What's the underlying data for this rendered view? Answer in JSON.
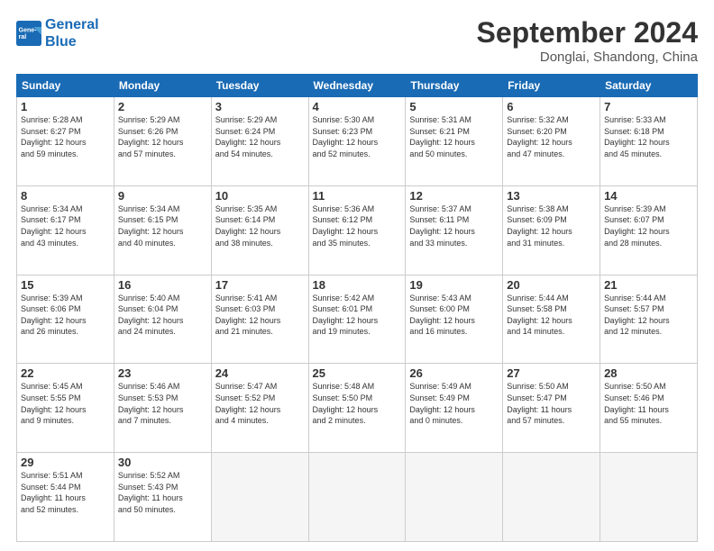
{
  "header": {
    "logo": {
      "line1": "General",
      "line2": "Blue"
    },
    "month": "September 2024",
    "location": "Donglai, Shandong, China"
  },
  "weekdays": [
    "Sunday",
    "Monday",
    "Tuesday",
    "Wednesday",
    "Thursday",
    "Friday",
    "Saturday"
  ],
  "weeks": [
    [
      {
        "day": 1,
        "info": "Sunrise: 5:28 AM\nSunset: 6:27 PM\nDaylight: 12 hours\nand 59 minutes."
      },
      {
        "day": 2,
        "info": "Sunrise: 5:29 AM\nSunset: 6:26 PM\nDaylight: 12 hours\nand 57 minutes."
      },
      {
        "day": 3,
        "info": "Sunrise: 5:29 AM\nSunset: 6:24 PM\nDaylight: 12 hours\nand 54 minutes."
      },
      {
        "day": 4,
        "info": "Sunrise: 5:30 AM\nSunset: 6:23 PM\nDaylight: 12 hours\nand 52 minutes."
      },
      {
        "day": 5,
        "info": "Sunrise: 5:31 AM\nSunset: 6:21 PM\nDaylight: 12 hours\nand 50 minutes."
      },
      {
        "day": 6,
        "info": "Sunrise: 5:32 AM\nSunset: 6:20 PM\nDaylight: 12 hours\nand 47 minutes."
      },
      {
        "day": 7,
        "info": "Sunrise: 5:33 AM\nSunset: 6:18 PM\nDaylight: 12 hours\nand 45 minutes."
      }
    ],
    [
      {
        "day": 8,
        "info": "Sunrise: 5:34 AM\nSunset: 6:17 PM\nDaylight: 12 hours\nand 43 minutes."
      },
      {
        "day": 9,
        "info": "Sunrise: 5:34 AM\nSunset: 6:15 PM\nDaylight: 12 hours\nand 40 minutes."
      },
      {
        "day": 10,
        "info": "Sunrise: 5:35 AM\nSunset: 6:14 PM\nDaylight: 12 hours\nand 38 minutes."
      },
      {
        "day": 11,
        "info": "Sunrise: 5:36 AM\nSunset: 6:12 PM\nDaylight: 12 hours\nand 35 minutes."
      },
      {
        "day": 12,
        "info": "Sunrise: 5:37 AM\nSunset: 6:11 PM\nDaylight: 12 hours\nand 33 minutes."
      },
      {
        "day": 13,
        "info": "Sunrise: 5:38 AM\nSunset: 6:09 PM\nDaylight: 12 hours\nand 31 minutes."
      },
      {
        "day": 14,
        "info": "Sunrise: 5:39 AM\nSunset: 6:07 PM\nDaylight: 12 hours\nand 28 minutes."
      }
    ],
    [
      {
        "day": 15,
        "info": "Sunrise: 5:39 AM\nSunset: 6:06 PM\nDaylight: 12 hours\nand 26 minutes."
      },
      {
        "day": 16,
        "info": "Sunrise: 5:40 AM\nSunset: 6:04 PM\nDaylight: 12 hours\nand 24 minutes."
      },
      {
        "day": 17,
        "info": "Sunrise: 5:41 AM\nSunset: 6:03 PM\nDaylight: 12 hours\nand 21 minutes."
      },
      {
        "day": 18,
        "info": "Sunrise: 5:42 AM\nSunset: 6:01 PM\nDaylight: 12 hours\nand 19 minutes."
      },
      {
        "day": 19,
        "info": "Sunrise: 5:43 AM\nSunset: 6:00 PM\nDaylight: 12 hours\nand 16 minutes."
      },
      {
        "day": 20,
        "info": "Sunrise: 5:44 AM\nSunset: 5:58 PM\nDaylight: 12 hours\nand 14 minutes."
      },
      {
        "day": 21,
        "info": "Sunrise: 5:44 AM\nSunset: 5:57 PM\nDaylight: 12 hours\nand 12 minutes."
      }
    ],
    [
      {
        "day": 22,
        "info": "Sunrise: 5:45 AM\nSunset: 5:55 PM\nDaylight: 12 hours\nand 9 minutes."
      },
      {
        "day": 23,
        "info": "Sunrise: 5:46 AM\nSunset: 5:53 PM\nDaylight: 12 hours\nand 7 minutes."
      },
      {
        "day": 24,
        "info": "Sunrise: 5:47 AM\nSunset: 5:52 PM\nDaylight: 12 hours\nand 4 minutes."
      },
      {
        "day": 25,
        "info": "Sunrise: 5:48 AM\nSunset: 5:50 PM\nDaylight: 12 hours\nand 2 minutes."
      },
      {
        "day": 26,
        "info": "Sunrise: 5:49 AM\nSunset: 5:49 PM\nDaylight: 12 hours\nand 0 minutes."
      },
      {
        "day": 27,
        "info": "Sunrise: 5:50 AM\nSunset: 5:47 PM\nDaylight: 11 hours\nand 57 minutes."
      },
      {
        "day": 28,
        "info": "Sunrise: 5:50 AM\nSunset: 5:46 PM\nDaylight: 11 hours\nand 55 minutes."
      }
    ],
    [
      {
        "day": 29,
        "info": "Sunrise: 5:51 AM\nSunset: 5:44 PM\nDaylight: 11 hours\nand 52 minutes."
      },
      {
        "day": 30,
        "info": "Sunrise: 5:52 AM\nSunset: 5:43 PM\nDaylight: 11 hours\nand 50 minutes."
      },
      null,
      null,
      null,
      null,
      null
    ]
  ]
}
